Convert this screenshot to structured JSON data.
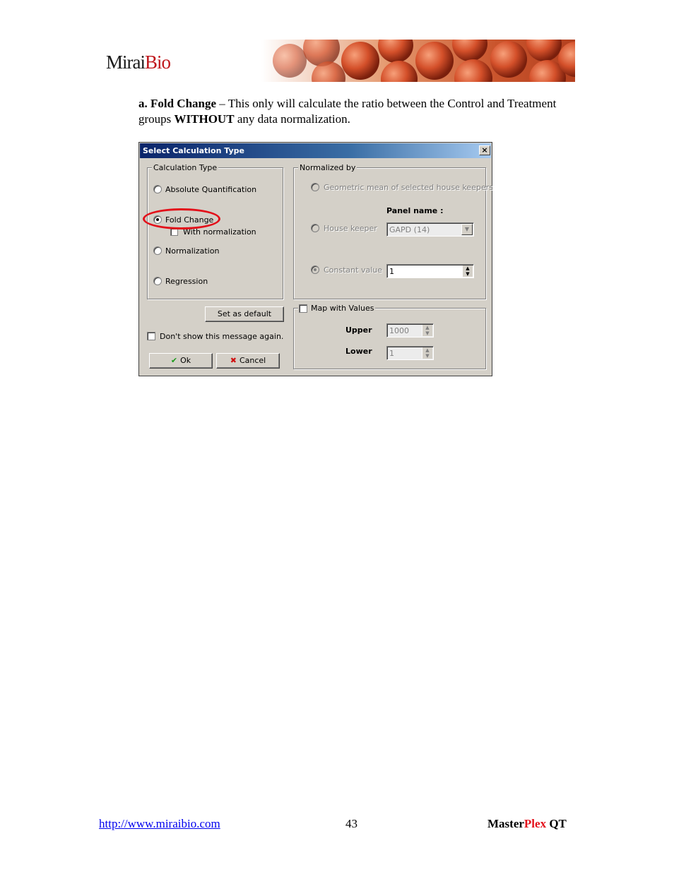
{
  "header": {
    "logo_main": "Mirai",
    "logo_accent": "Bio"
  },
  "intro": {
    "heading": "a. Fold Change",
    "text_1": " – This only will calculate the ratio between the Control and Treatment groups ",
    "emphasis": "WITHOUT",
    "text_2": " any data normalization."
  },
  "dialog": {
    "title": "Select Calculation Type",
    "close_glyph": "×",
    "calculation_type": {
      "legend": "Calculation Type",
      "options": [
        {
          "label": "Absolute Quantification",
          "selected": false
        },
        {
          "label": "Fold Change",
          "selected": true
        },
        {
          "label": "Normalization",
          "selected": false
        },
        {
          "label": "Regression",
          "selected": false
        }
      ],
      "with_normalization_label": "With normalization"
    },
    "normalized_by": {
      "legend": "Normalized by",
      "geometric_mean_label": "Geometric mean of selected house keepers",
      "panel_name_label": "Panel name :",
      "house_keeper_label": "House keeper",
      "house_keeper_value": "GAPD (14)",
      "constant_value_label": "Constant value",
      "constant_value": "1"
    },
    "map_with_values": {
      "legend": "Map with Values",
      "upper_label": "Upper",
      "upper_value": "1000",
      "lower_label": "Lower",
      "lower_value": "1"
    },
    "set_default_label": "Set as default",
    "dont_show_label": "Don't show this message again.",
    "ok_label": "Ok",
    "cancel_label": "Cancel",
    "ok_icon": "check-icon",
    "cancel_icon": "x-icon"
  },
  "footer": {
    "url": "http://www.miraibio.com",
    "page_number": "43",
    "product_1": "Master",
    "product_2": "Plex",
    "product_3": " QT"
  },
  "colors": {
    "highlight": "#e3101a",
    "brand_red": "#c0171c",
    "title_bar": "#0a246a"
  }
}
